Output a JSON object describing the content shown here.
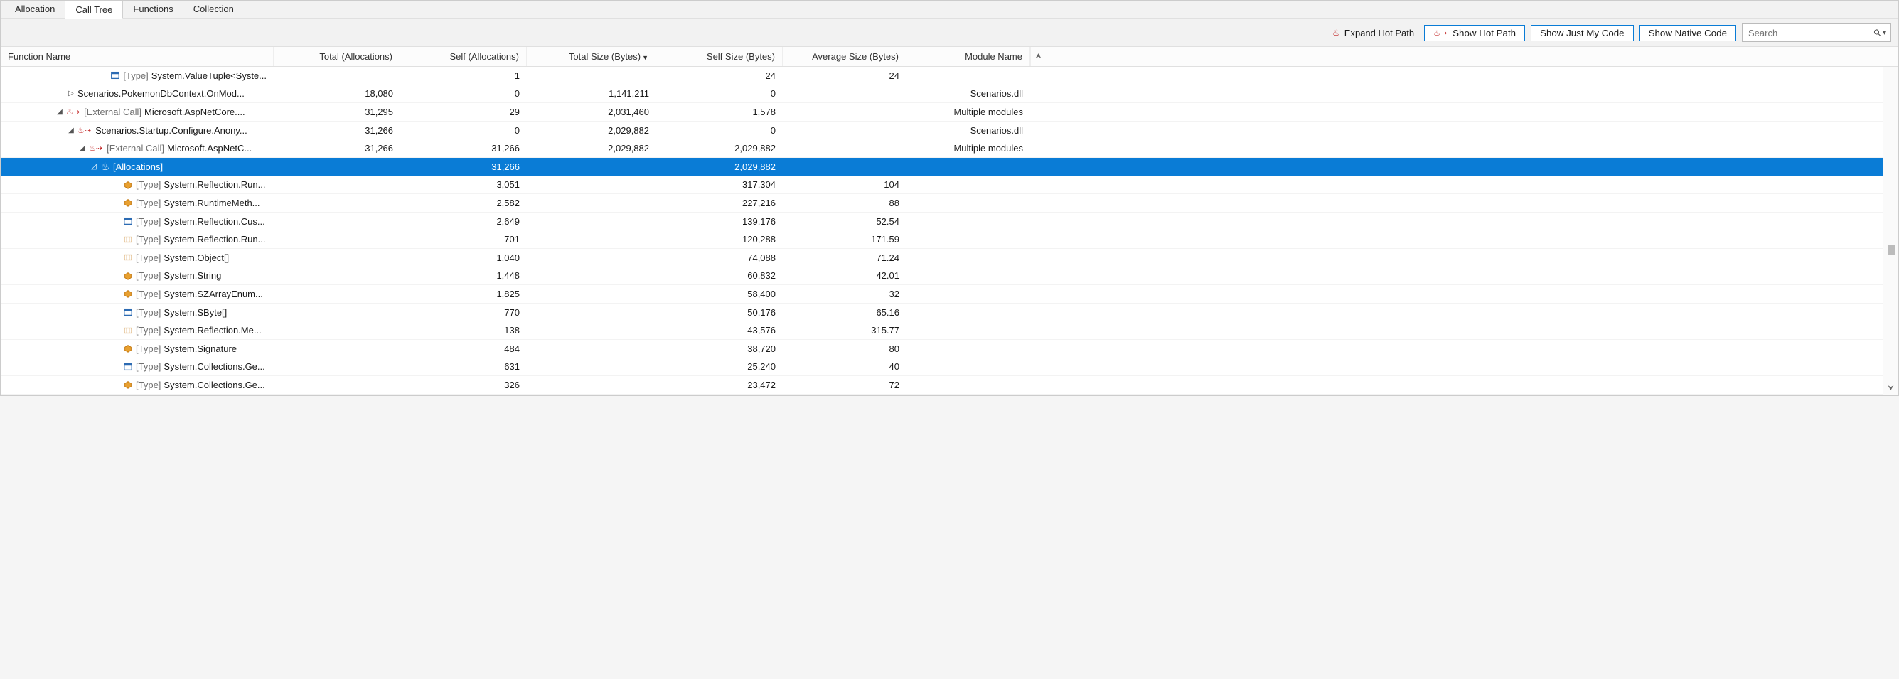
{
  "tabs": {
    "items": [
      "Allocation",
      "Call Tree",
      "Functions",
      "Collection"
    ],
    "active_index": 1
  },
  "toolbar": {
    "expand_hot_path": "Expand Hot Path",
    "show_hot_path": "Show Hot Path",
    "show_just_my_code": "Show Just My Code",
    "show_native_code": "Show Native Code",
    "search_placeholder": "Search"
  },
  "columns": {
    "function_name": "Function Name",
    "total_allocations": "Total (Allocations)",
    "self_allocations": "Self (Allocations)",
    "total_size_bytes": "Total Size (Bytes)",
    "self_size_bytes": "Self Size (Bytes)",
    "average_size_bytes": "Average Size (Bytes)",
    "module_name": "Module Name"
  },
  "rows": [
    {
      "indent": 8,
      "expander": "",
      "flame": false,
      "icon": "struct",
      "prefix": "[Type] ",
      "name": "System.ValueTuple<Syste...",
      "ta": "",
      "sa": "1",
      "tsb": "",
      "ssb": "24",
      "asb": "24",
      "mn": ""
    },
    {
      "indent": 5,
      "expander": "▷",
      "flame": false,
      "icon": "",
      "prefix": "",
      "name": "Scenarios.PokemonDbContext.OnMod...",
      "ta": "18,080",
      "sa": "0",
      "tsb": "1,141,211",
      "ssb": "0",
      "asb": "",
      "mn": "Scenarios.dll"
    },
    {
      "indent": 4,
      "expander": "◢",
      "flame": true,
      "icon": "",
      "prefix": "[External Call] ",
      "name": "Microsoft.AspNetCore....",
      "ta": "31,295",
      "sa": "29",
      "tsb": "2,031,460",
      "ssb": "1,578",
      "asb": "",
      "mn": "Multiple modules"
    },
    {
      "indent": 5,
      "expander": "◢",
      "flame": true,
      "icon": "",
      "prefix": "",
      "name": "Scenarios.Startup.Configure.Anony...",
      "ta": "31,266",
      "sa": "0",
      "tsb": "2,029,882",
      "ssb": "0",
      "asb": "",
      "mn": "Scenarios.dll"
    },
    {
      "indent": 6,
      "expander": "◢",
      "flame": true,
      "icon": "",
      "prefix": "[External Call] ",
      "name": "Microsoft.AspNetC...",
      "ta": "31,266",
      "sa": "31,266",
      "tsb": "2,029,882",
      "ssb": "2,029,882",
      "asb": "",
      "mn": "Multiple modules"
    },
    {
      "indent": 7,
      "expander": "◿",
      "flame": false,
      "icon": "flame",
      "prefix": "",
      "name": "[Allocations]",
      "ta": "",
      "sa": "31,266",
      "tsb": "",
      "ssb": "2,029,882",
      "asb": "",
      "mn": "",
      "selected": true
    },
    {
      "indent": 9,
      "expander": "",
      "flame": false,
      "icon": "class",
      "prefix": "[Type] ",
      "name": "System.Reflection.Run...",
      "ta": "",
      "sa": "3,051",
      "tsb": "",
      "ssb": "317,304",
      "asb": "104",
      "mn": ""
    },
    {
      "indent": 9,
      "expander": "",
      "flame": false,
      "icon": "class",
      "prefix": "[Type] ",
      "name": "System.RuntimeMeth...",
      "ta": "",
      "sa": "2,582",
      "tsb": "",
      "ssb": "227,216",
      "asb": "88",
      "mn": ""
    },
    {
      "indent": 9,
      "expander": "",
      "flame": false,
      "icon": "struct",
      "prefix": "[Type] ",
      "name": "System.Reflection.Cus...",
      "ta": "",
      "sa": "2,649",
      "tsb": "",
      "ssb": "139,176",
      "asb": "52.54",
      "mn": ""
    },
    {
      "indent": 9,
      "expander": "",
      "flame": false,
      "icon": "array",
      "prefix": "[Type] ",
      "name": "System.Reflection.Run...",
      "ta": "",
      "sa": "701",
      "tsb": "",
      "ssb": "120,288",
      "asb": "171.59",
      "mn": ""
    },
    {
      "indent": 9,
      "expander": "",
      "flame": false,
      "icon": "array",
      "prefix": "[Type] ",
      "name": "System.Object[]",
      "ta": "",
      "sa": "1,040",
      "tsb": "",
      "ssb": "74,088",
      "asb": "71.24",
      "mn": ""
    },
    {
      "indent": 9,
      "expander": "",
      "flame": false,
      "icon": "class",
      "prefix": "[Type] ",
      "name": "System.String",
      "ta": "",
      "sa": "1,448",
      "tsb": "",
      "ssb": "60,832",
      "asb": "42.01",
      "mn": ""
    },
    {
      "indent": 9,
      "expander": "",
      "flame": false,
      "icon": "class",
      "prefix": "[Type] ",
      "name": "System.SZArrayEnum...",
      "ta": "",
      "sa": "1,825",
      "tsb": "",
      "ssb": "58,400",
      "asb": "32",
      "mn": ""
    },
    {
      "indent": 9,
      "expander": "",
      "flame": false,
      "icon": "struct",
      "prefix": "[Type] ",
      "name": "System.SByte[]",
      "ta": "",
      "sa": "770",
      "tsb": "",
      "ssb": "50,176",
      "asb": "65.16",
      "mn": ""
    },
    {
      "indent": 9,
      "expander": "",
      "flame": false,
      "icon": "array",
      "prefix": "[Type] ",
      "name": "System.Reflection.Me...",
      "ta": "",
      "sa": "138",
      "tsb": "",
      "ssb": "43,576",
      "asb": "315.77",
      "mn": ""
    },
    {
      "indent": 9,
      "expander": "",
      "flame": false,
      "icon": "class",
      "prefix": "[Type] ",
      "name": "System.Signature",
      "ta": "",
      "sa": "484",
      "tsb": "",
      "ssb": "38,720",
      "asb": "80",
      "mn": ""
    },
    {
      "indent": 9,
      "expander": "",
      "flame": false,
      "icon": "struct",
      "prefix": "[Type] ",
      "name": "System.Collections.Ge...",
      "ta": "",
      "sa": "631",
      "tsb": "",
      "ssb": "25,240",
      "asb": "40",
      "mn": ""
    },
    {
      "indent": 9,
      "expander": "",
      "flame": false,
      "icon": "class",
      "prefix": "[Type] ",
      "name": "System.Collections.Ge...",
      "ta": "",
      "sa": "326",
      "tsb": "",
      "ssb": "23,472",
      "asb": "72",
      "mn": ""
    }
  ]
}
